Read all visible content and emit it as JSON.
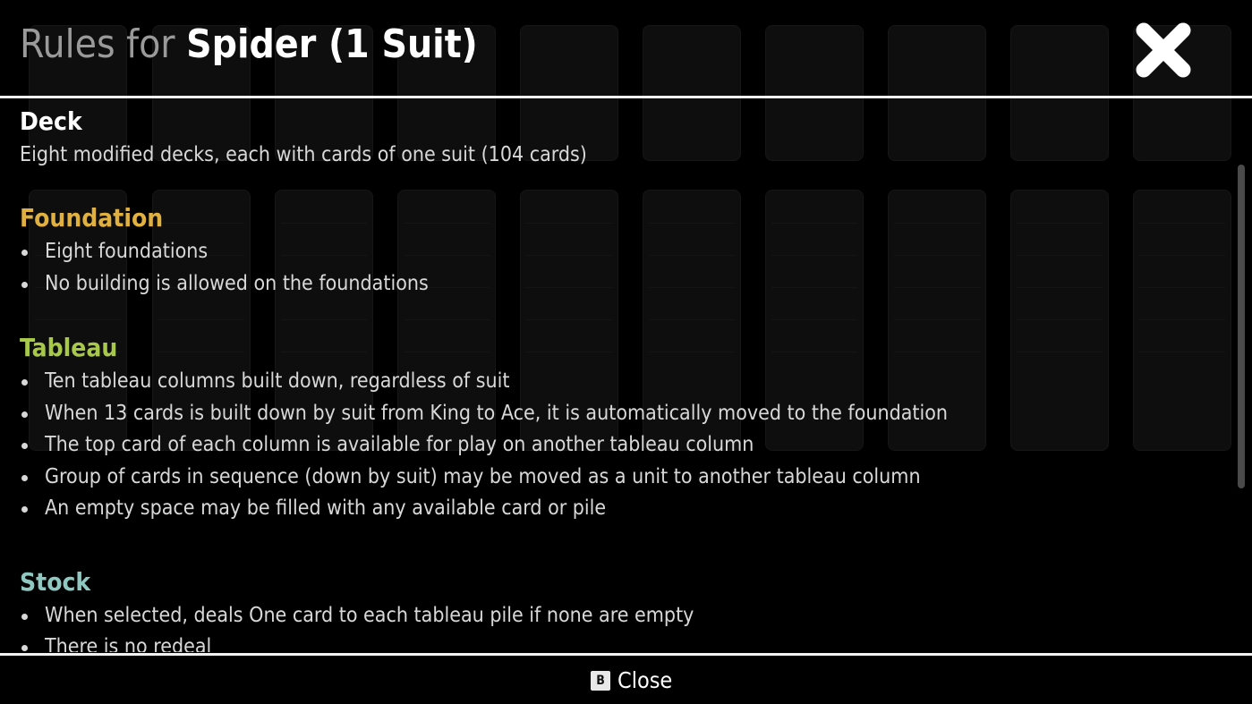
{
  "header": {
    "prefix": "Rules for ",
    "game_name": "Spider (1 Suit)"
  },
  "sections": {
    "deck": {
      "heading": "Deck",
      "color": "#ffffff",
      "text": "Eight modified decks, each with cards of one suit (104 cards)"
    },
    "foundation": {
      "heading": "Foundation",
      "color": "#e0b040",
      "items": [
        "Eight foundations",
        "No building is allowed on the foundations"
      ]
    },
    "tableau": {
      "heading": "Tableau",
      "color": "#a8c84a",
      "items": [
        "Ten tableau columns built down, regardless of suit",
        "When 13 cards is built down by suit from King to Ace, it is automatically moved to the foundation",
        "The top card of each column is available for play on another tableau column",
        "Group of cards in sequence (down by suit) may be moved as a unit to another tableau column",
        "An empty space may be filled with any available card or pile"
      ]
    },
    "stock": {
      "heading": "Stock",
      "color": "#8fc8c0",
      "items": [
        "When selected, deals One card to each tableau pile if none are empty",
        "There is no redeal"
      ]
    }
  },
  "footer": {
    "key": "B",
    "close_label": "Close"
  },
  "icons": {
    "close": "close-x-icon"
  }
}
